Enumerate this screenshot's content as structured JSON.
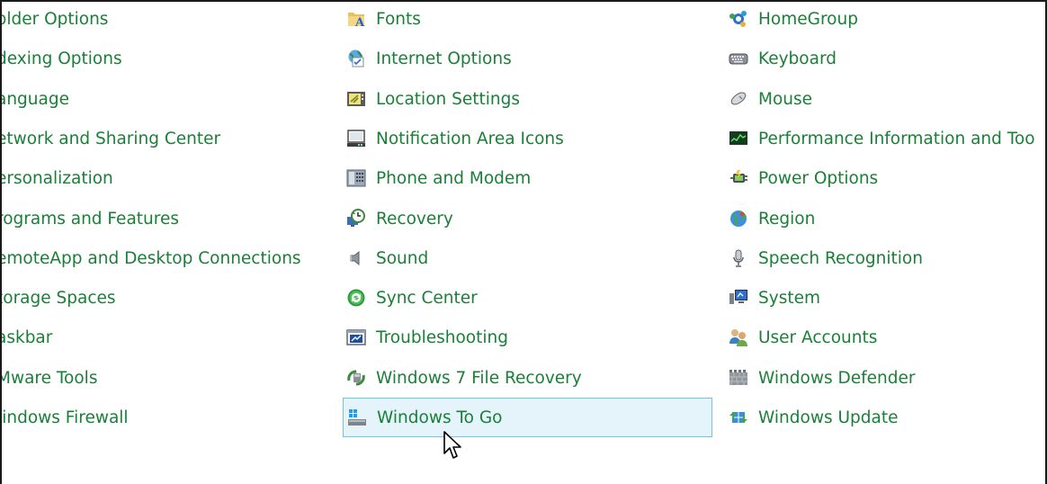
{
  "window_title": "",
  "columns": [
    {
      "items": [
        {
          "label": "Folder Options",
          "visible_label": "older Options"
        },
        {
          "label": "Indexing Options",
          "visible_label": "dexing Options"
        },
        {
          "label": "Language",
          "visible_label": "anguage"
        },
        {
          "label": "Network and Sharing Center",
          "visible_label": "etwork and Sharing Center"
        },
        {
          "label": "Personalization",
          "visible_label": "ersonalization"
        },
        {
          "label": "Programs and Features",
          "visible_label": "rograms and Features"
        },
        {
          "label": "RemoteApp and Desktop Connections",
          "visible_label": "emoteApp and Desktop Connections"
        },
        {
          "label": "Storage Spaces",
          "visible_label": "torage Spaces"
        },
        {
          "label": "Taskbar",
          "visible_label": "askbar"
        },
        {
          "label": "VMware Tools",
          "visible_label": "Mware Tools"
        },
        {
          "label": "Windows Firewall",
          "visible_label": "/indows Firewall"
        }
      ]
    },
    {
      "items": [
        {
          "label": "Fonts",
          "icon": "fonts-folder-icon"
        },
        {
          "label": "Internet Options",
          "icon": "internet-options-icon"
        },
        {
          "label": "Location Settings",
          "icon": "location-settings-icon"
        },
        {
          "label": "Notification Area Icons",
          "icon": "notification-area-icon"
        },
        {
          "label": "Phone and Modem",
          "icon": "phone-modem-icon"
        },
        {
          "label": "Recovery",
          "icon": "recovery-icon"
        },
        {
          "label": "Sound",
          "icon": "speaker-icon"
        },
        {
          "label": "Sync Center",
          "icon": "sync-center-icon"
        },
        {
          "label": "Troubleshooting",
          "icon": "troubleshooting-icon"
        },
        {
          "label": "Windows 7 File Recovery",
          "icon": "file-recovery-icon"
        },
        {
          "label": "Windows To Go",
          "icon": "windows-to-go-icon",
          "selected": true
        }
      ]
    },
    {
      "items": [
        {
          "label": "HomeGroup",
          "icon": "homegroup-icon"
        },
        {
          "label": "Keyboard",
          "icon": "keyboard-icon"
        },
        {
          "label": "Mouse",
          "icon": "mouse-icon"
        },
        {
          "label": "Performance Information and Too",
          "icon": "performance-icon"
        },
        {
          "label": "Power Options",
          "icon": "power-options-icon"
        },
        {
          "label": "Region",
          "icon": "region-globe-icon"
        },
        {
          "label": "Speech Recognition",
          "icon": "microphone-icon"
        },
        {
          "label": "System",
          "icon": "system-monitor-icon"
        },
        {
          "label": "User Accounts",
          "icon": "user-accounts-icon"
        },
        {
          "label": "Windows Defender",
          "icon": "windows-defender-icon"
        },
        {
          "label": "Windows Update",
          "icon": "windows-update-icon"
        }
      ]
    }
  ],
  "colors": {
    "link_text": "#1a7f37",
    "selection_fill": "#e5f3fb",
    "selection_border": "#7ac0e4"
  }
}
